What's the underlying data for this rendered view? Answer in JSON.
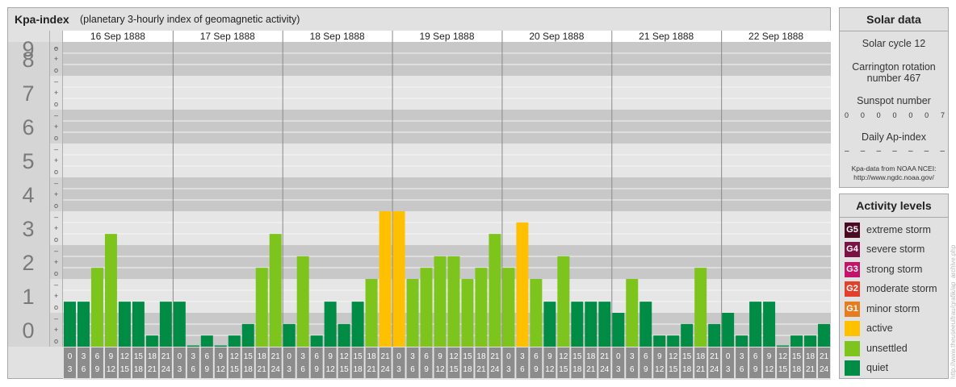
{
  "header": {
    "title": "Kpa-index",
    "subtitle": "(planetary 3-hourly index of geomagnetic activity)"
  },
  "chart_data": {
    "type": "bar",
    "title": "Kpa-index",
    "subtitle": "(planetary 3-hourly index of geomagnetic activity)",
    "ylim": [
      0,
      9
    ],
    "y_major_ticks": [
      "0",
      "1",
      "2",
      "3",
      "4",
      "5",
      "6",
      "7",
      "8",
      "9"
    ],
    "y_minor_ticks": [
      "o",
      "+",
      "–"
    ],
    "days": [
      "16 Sep 1888",
      "17 Sep 1888",
      "18 Sep 1888",
      "19 Sep 1888",
      "20 Sep 1888",
      "21 Sep 1888",
      "22 Sep 1888"
    ],
    "interval_start_labels": [
      "0",
      "3",
      "6",
      "9",
      "12",
      "15",
      "18",
      "21"
    ],
    "interval_end_labels": [
      "3",
      "6",
      "9",
      "12",
      "15",
      "18",
      "21",
      "24"
    ],
    "values": [
      [
        1.33,
        1.33,
        2.33,
        3.33,
        1.33,
        1.33,
        0.33,
        1.33
      ],
      [
        1.33,
        0.0,
        0.33,
        0.0,
        0.33,
        0.67,
        2.33,
        3.33
      ],
      [
        0.67,
        2.67,
        0.33,
        1.33,
        0.67,
        1.33,
        2.0,
        4.0
      ],
      [
        4.0,
        2.0,
        2.33,
        2.67,
        2.67,
        2.0,
        2.33,
        3.33
      ],
      [
        2.33,
        3.67,
        2.0,
        1.33,
        2.67,
        1.33,
        1.33,
        1.33
      ],
      [
        1.0,
        2.0,
        1.33,
        0.33,
        0.33,
        0.67,
        2.33,
        0.67
      ],
      [
        1.0,
        0.33,
        1.33,
        1.33,
        0.0,
        0.33,
        0.33,
        0.67
      ]
    ],
    "levels": [
      {
        "code": "G5",
        "name": "extreme storm",
        "color": "#4a0a24"
      },
      {
        "code": "G4",
        "name": "severe storm",
        "color": "#7a1246"
      },
      {
        "code": "G3",
        "name": "strong storm",
        "color": "#c3136b"
      },
      {
        "code": "G2",
        "name": "moderate storm",
        "color": "#e3402c"
      },
      {
        "code": "G1",
        "name": "minor storm",
        "color": "#e57c1d"
      },
      {
        "code": "",
        "name": "active",
        "color": "#ffc000"
      },
      {
        "code": "",
        "name": "unsettled",
        "color": "#7dc41c"
      },
      {
        "code": "",
        "name": "quiet",
        "color": "#008c45"
      }
    ]
  },
  "solar": {
    "title": "Solar data",
    "cycle": "Solar cycle 12",
    "rotation_line1": "Carrington rotation",
    "rotation_line2": "number 467",
    "sunspot_title": "Sunspot number",
    "sunspots": [
      "0",
      "0",
      "0",
      "0",
      "0",
      "0",
      "7"
    ],
    "ap_title": "Daily Ap-index",
    "ap_values": [
      "–",
      "–",
      "–",
      "–",
      "–",
      "–",
      "–"
    ],
    "source_line1": "Kpa-data from NOAA NCEI:",
    "source_line2": "http://www.ngdc.noaa.gov/"
  },
  "activity": {
    "title": "Activity levels"
  },
  "watermark": "http://www.theuseeuifrau/grafik/ap_archive.php"
}
